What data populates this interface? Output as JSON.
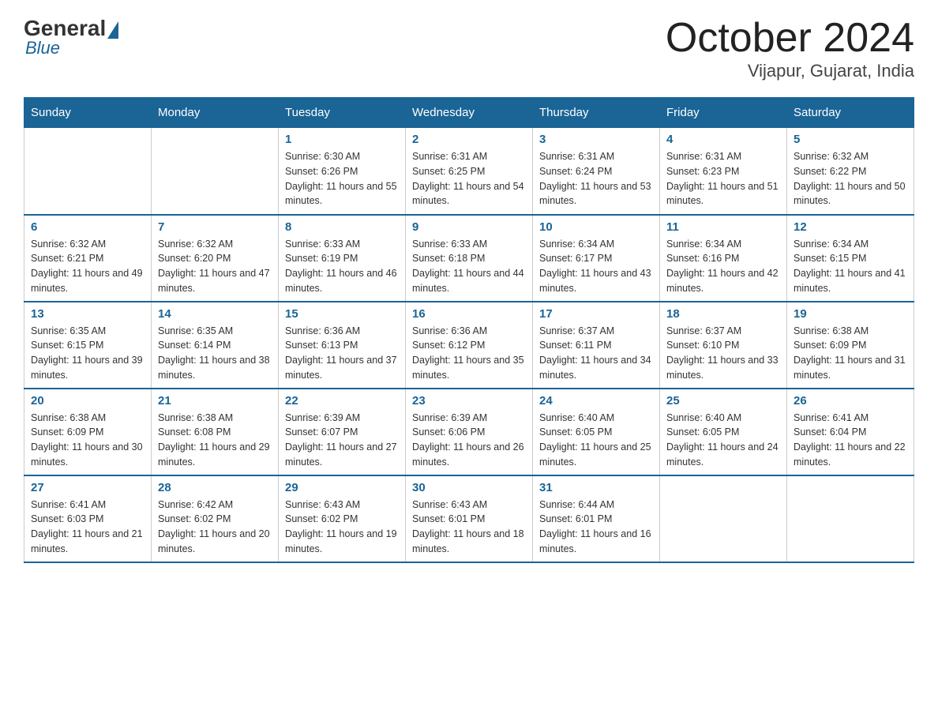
{
  "logo": {
    "general": "General",
    "blue": "Blue",
    "subtitle": "Blue"
  },
  "header": {
    "month": "October 2024",
    "location": "Vijapur, Gujarat, India"
  },
  "weekdays": [
    "Sunday",
    "Monday",
    "Tuesday",
    "Wednesday",
    "Thursday",
    "Friday",
    "Saturday"
  ],
  "weeks": [
    [
      null,
      null,
      {
        "day": "1",
        "sunrise": "Sunrise: 6:30 AM",
        "sunset": "Sunset: 6:26 PM",
        "daylight": "Daylight: 11 hours and 55 minutes."
      },
      {
        "day": "2",
        "sunrise": "Sunrise: 6:31 AM",
        "sunset": "Sunset: 6:25 PM",
        "daylight": "Daylight: 11 hours and 54 minutes."
      },
      {
        "day": "3",
        "sunrise": "Sunrise: 6:31 AM",
        "sunset": "Sunset: 6:24 PM",
        "daylight": "Daylight: 11 hours and 53 minutes."
      },
      {
        "day": "4",
        "sunrise": "Sunrise: 6:31 AM",
        "sunset": "Sunset: 6:23 PM",
        "daylight": "Daylight: 11 hours and 51 minutes."
      },
      {
        "day": "5",
        "sunrise": "Sunrise: 6:32 AM",
        "sunset": "Sunset: 6:22 PM",
        "daylight": "Daylight: 11 hours and 50 minutes."
      }
    ],
    [
      {
        "day": "6",
        "sunrise": "Sunrise: 6:32 AM",
        "sunset": "Sunset: 6:21 PM",
        "daylight": "Daylight: 11 hours and 49 minutes."
      },
      {
        "day": "7",
        "sunrise": "Sunrise: 6:32 AM",
        "sunset": "Sunset: 6:20 PM",
        "daylight": "Daylight: 11 hours and 47 minutes."
      },
      {
        "day": "8",
        "sunrise": "Sunrise: 6:33 AM",
        "sunset": "Sunset: 6:19 PM",
        "daylight": "Daylight: 11 hours and 46 minutes."
      },
      {
        "day": "9",
        "sunrise": "Sunrise: 6:33 AM",
        "sunset": "Sunset: 6:18 PM",
        "daylight": "Daylight: 11 hours and 44 minutes."
      },
      {
        "day": "10",
        "sunrise": "Sunrise: 6:34 AM",
        "sunset": "Sunset: 6:17 PM",
        "daylight": "Daylight: 11 hours and 43 minutes."
      },
      {
        "day": "11",
        "sunrise": "Sunrise: 6:34 AM",
        "sunset": "Sunset: 6:16 PM",
        "daylight": "Daylight: 11 hours and 42 minutes."
      },
      {
        "day": "12",
        "sunrise": "Sunrise: 6:34 AM",
        "sunset": "Sunset: 6:15 PM",
        "daylight": "Daylight: 11 hours and 41 minutes."
      }
    ],
    [
      {
        "day": "13",
        "sunrise": "Sunrise: 6:35 AM",
        "sunset": "Sunset: 6:15 PM",
        "daylight": "Daylight: 11 hours and 39 minutes."
      },
      {
        "day": "14",
        "sunrise": "Sunrise: 6:35 AM",
        "sunset": "Sunset: 6:14 PM",
        "daylight": "Daylight: 11 hours and 38 minutes."
      },
      {
        "day": "15",
        "sunrise": "Sunrise: 6:36 AM",
        "sunset": "Sunset: 6:13 PM",
        "daylight": "Daylight: 11 hours and 37 minutes."
      },
      {
        "day": "16",
        "sunrise": "Sunrise: 6:36 AM",
        "sunset": "Sunset: 6:12 PM",
        "daylight": "Daylight: 11 hours and 35 minutes."
      },
      {
        "day": "17",
        "sunrise": "Sunrise: 6:37 AM",
        "sunset": "Sunset: 6:11 PM",
        "daylight": "Daylight: 11 hours and 34 minutes."
      },
      {
        "day": "18",
        "sunrise": "Sunrise: 6:37 AM",
        "sunset": "Sunset: 6:10 PM",
        "daylight": "Daylight: 11 hours and 33 minutes."
      },
      {
        "day": "19",
        "sunrise": "Sunrise: 6:38 AM",
        "sunset": "Sunset: 6:09 PM",
        "daylight": "Daylight: 11 hours and 31 minutes."
      }
    ],
    [
      {
        "day": "20",
        "sunrise": "Sunrise: 6:38 AM",
        "sunset": "Sunset: 6:09 PM",
        "daylight": "Daylight: 11 hours and 30 minutes."
      },
      {
        "day": "21",
        "sunrise": "Sunrise: 6:38 AM",
        "sunset": "Sunset: 6:08 PM",
        "daylight": "Daylight: 11 hours and 29 minutes."
      },
      {
        "day": "22",
        "sunrise": "Sunrise: 6:39 AM",
        "sunset": "Sunset: 6:07 PM",
        "daylight": "Daylight: 11 hours and 27 minutes."
      },
      {
        "day": "23",
        "sunrise": "Sunrise: 6:39 AM",
        "sunset": "Sunset: 6:06 PM",
        "daylight": "Daylight: 11 hours and 26 minutes."
      },
      {
        "day": "24",
        "sunrise": "Sunrise: 6:40 AM",
        "sunset": "Sunset: 6:05 PM",
        "daylight": "Daylight: 11 hours and 25 minutes."
      },
      {
        "day": "25",
        "sunrise": "Sunrise: 6:40 AM",
        "sunset": "Sunset: 6:05 PM",
        "daylight": "Daylight: 11 hours and 24 minutes."
      },
      {
        "day": "26",
        "sunrise": "Sunrise: 6:41 AM",
        "sunset": "Sunset: 6:04 PM",
        "daylight": "Daylight: 11 hours and 22 minutes."
      }
    ],
    [
      {
        "day": "27",
        "sunrise": "Sunrise: 6:41 AM",
        "sunset": "Sunset: 6:03 PM",
        "daylight": "Daylight: 11 hours and 21 minutes."
      },
      {
        "day": "28",
        "sunrise": "Sunrise: 6:42 AM",
        "sunset": "Sunset: 6:02 PM",
        "daylight": "Daylight: 11 hours and 20 minutes."
      },
      {
        "day": "29",
        "sunrise": "Sunrise: 6:43 AM",
        "sunset": "Sunset: 6:02 PM",
        "daylight": "Daylight: 11 hours and 19 minutes."
      },
      {
        "day": "30",
        "sunrise": "Sunrise: 6:43 AM",
        "sunset": "Sunset: 6:01 PM",
        "daylight": "Daylight: 11 hours and 18 minutes."
      },
      {
        "day": "31",
        "sunrise": "Sunrise: 6:44 AM",
        "sunset": "Sunset: 6:01 PM",
        "daylight": "Daylight: 11 hours and 16 minutes."
      },
      null,
      null
    ]
  ]
}
